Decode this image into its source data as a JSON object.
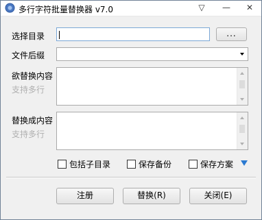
{
  "window": {
    "title": "多行字符批量替换器 v7.0",
    "title_buttons": {
      "dropdown": "▽",
      "minimize": "—",
      "close": "✕"
    }
  },
  "form": {
    "dir": {
      "label": "选择目录",
      "value": "",
      "browse_label": "..."
    },
    "suffix": {
      "label": "文件后缀",
      "value": ""
    },
    "find": {
      "label": "欲替换内容",
      "hint": "支持多行",
      "value": ""
    },
    "replace": {
      "label": "替换成内容",
      "hint": "支持多行",
      "value": ""
    }
  },
  "options": {
    "include_subdirs": "包括子目录",
    "save_backup": "保存备份",
    "save_scheme": "保存方案"
  },
  "buttons": {
    "register": "注册",
    "replace": "替换(R)",
    "close": "关闭(E)"
  },
  "colors": {
    "expand_arrow": "#2b7ad1",
    "focus_border": "#7aa7d6"
  }
}
